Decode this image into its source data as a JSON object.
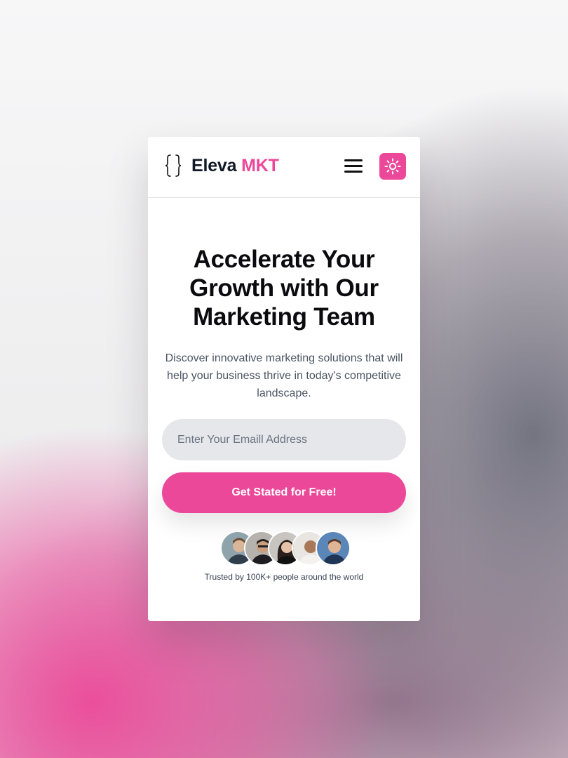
{
  "brand": {
    "name_primary": "Eleva",
    "name_accent": "MKT",
    "accent_color": "#ec4899"
  },
  "nav": {
    "menu_icon": "hamburger-menu-icon",
    "theme_icon": "sun-icon"
  },
  "hero": {
    "title": "Accelerate Your Growth with Our Marketing Team",
    "subtitle": "Discover innovative marketing solutions that will help your business thrive in today's competitive landscape."
  },
  "signup": {
    "email_placeholder": "Enter Your Emaill Address",
    "email_value": "",
    "cta_label": "Get Stated for Free!"
  },
  "social_proof": {
    "avatar_count": 5,
    "trust_text": "Trusted by 100K+ people around the world"
  }
}
